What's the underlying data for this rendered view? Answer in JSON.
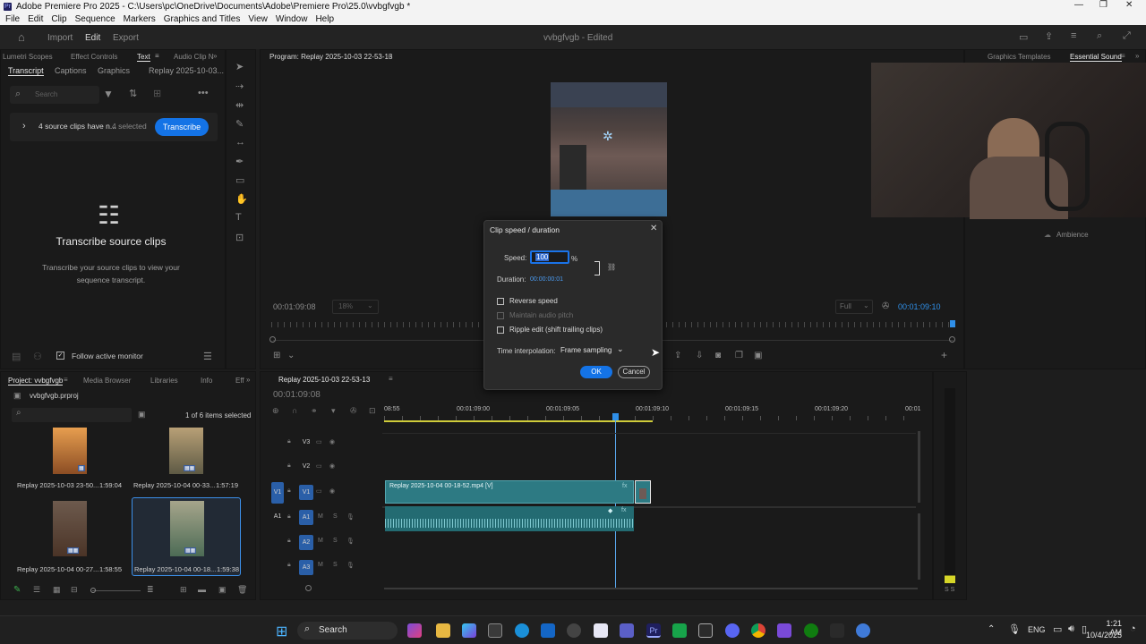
{
  "window": {
    "title": "Adobe Premiere Pro 2025 - C:\\Users\\pc\\OneDrive\\Documents\\Adobe\\Premiere Pro\\25.0\\vvbgfvgb *",
    "controls": [
      "—",
      "❐",
      "✕"
    ]
  },
  "menu": [
    "File",
    "Edit",
    "Clip",
    "Sequence",
    "Markers",
    "Graphics and Titles",
    "View",
    "Window",
    "Help"
  ],
  "workspace": {
    "tabs": [
      "Import",
      "Edit",
      "Export"
    ],
    "active_tab": "Edit",
    "project_status": "vvbgfvgb - Edited"
  },
  "left_panel": {
    "panel_tabs": [
      "Lumetri Scopes",
      "Effect Controls",
      "Text",
      "Audio Clip N"
    ],
    "sub_tabs": [
      "Transcript",
      "Captions",
      "Graphics",
      "Replay 2025-10-03..."
    ],
    "search_placeholder": "Search",
    "source_clips_text": "4 source clips have n...",
    "selected_text": "4 selected",
    "transcribe_button": "Transcribe",
    "heading": "Transcribe source clips",
    "body": "Transcribe your source clips to view your sequence transcript.",
    "follow_label": "Follow active monitor"
  },
  "program_monitor": {
    "title": "Program: Replay 2025-10-03 22-53-13",
    "timecode_left": "00:01:09:08",
    "zoom": "18%",
    "quality": "Full",
    "timecode_right": "00:01:09:10"
  },
  "right_panel": {
    "tabs": [
      "Graphics Templates",
      "Essential Sound"
    ],
    "active_tab": "Essential Sound",
    "ambience_label": "Ambience"
  },
  "dialog": {
    "title": "Clip speed / duration",
    "speed_label": "Speed:",
    "speed_value": "100",
    "speed_unit": "%",
    "duration_label": "Duration:",
    "duration_value": "00:00:00:01",
    "reverse_speed": "Reverse speed",
    "maintain_pitch": "Maintain audio pitch",
    "ripple_edit": "Ripple edit (shift trailing clips)",
    "interp_label": "Time interpolation:",
    "interp_value": "Frame sampling",
    "ok": "OK",
    "cancel": "Cancel"
  },
  "project_panel": {
    "tabs": [
      "Project: vvbgfvgb",
      "Media Browser",
      "Libraries",
      "Info",
      "Eff"
    ],
    "project_file": "vvbgfvgb.prproj",
    "selection_count": "1 of 6 items selected",
    "items": [
      {
        "name": "Replay 2025-10-03 23-50...",
        "duration": "1:59:04"
      },
      {
        "name": "Replay 2025-10-04 00-33...",
        "duration": "1:57:19"
      },
      {
        "name": "Replay 2025-10-04 00-27...",
        "duration": "1:58:55"
      },
      {
        "name": "Replay 2025-10-04 00-18...",
        "duration": "1:59:38"
      }
    ]
  },
  "timeline": {
    "title": "Replay 2025-10-03 22-53-13",
    "timecode": "00:01:09:08",
    "ruler": [
      "08:55",
      "00:01:09:00",
      "00:01:09:05",
      "00:01:09:10",
      "00:01:09:15",
      "00:01:09:20",
      "00:01"
    ],
    "tracks": [
      "V3",
      "V2",
      "V1",
      "A1",
      "A2",
      "A3"
    ],
    "source_patches": [
      "V1",
      "A1"
    ],
    "video_clip": "Replay 2025-10-04 00-18-52.mp4 [V]",
    "meter_label": "S S"
  },
  "taskbar": {
    "search": "Search",
    "lang": "ENG",
    "time": "1:21 AM",
    "date": "10/4/2025"
  }
}
